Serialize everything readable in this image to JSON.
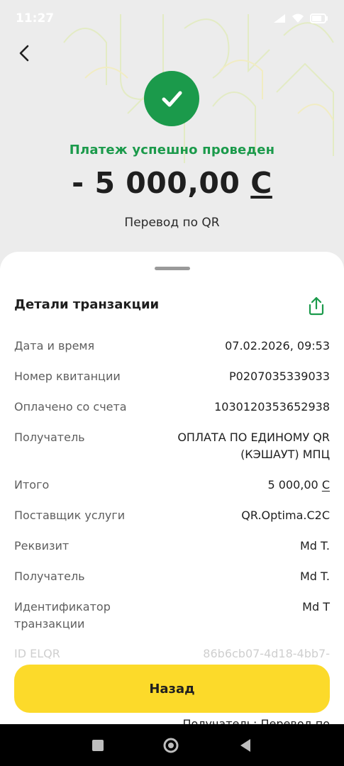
{
  "status_bar": {
    "time": "11:27"
  },
  "header": {
    "status_text": "Платеж успешно проведен",
    "amount_number": "- 5 000,00",
    "currency_symbol": "С",
    "subtitle": "Перевод по QR"
  },
  "details": {
    "title": "Детали транзакции",
    "rows": [
      {
        "label": "Дата и время",
        "value": "07.02.2026, 09:53"
      },
      {
        "label": "Номер квитанции",
        "value": "P0207035339033"
      },
      {
        "label": "Оплачено со счета",
        "value": "1030120353652938"
      },
      {
        "label": "Получатель",
        "value": "ОПЛАТА ПО ЕДИНОМУ QR (КЭШАУТ) МПЦ"
      },
      {
        "label": "Итого",
        "value": "5 000,00",
        "currency": "С"
      },
      {
        "label": "Поставщик услуги",
        "value": "QR.Optima.C2C"
      },
      {
        "label": "Реквизит",
        "value": "Md T."
      },
      {
        "label": "Получатель",
        "value": "Md T."
      },
      {
        "label": "Идентификатор транзакции",
        "value": "Md T"
      },
      {
        "label": "ID ELQR",
        "value": "86b6cb07-4d18-4bb7-"
      }
    ],
    "footer_text": "Получатель: Перевод по"
  },
  "actions": {
    "back_label": "Назад"
  },
  "colors": {
    "accent_green": "#1b9a4b",
    "button_yellow": "#fcda2a"
  },
  "icons": [
    "back-arrow-icon",
    "check-icon",
    "share-icon",
    "square-icon",
    "circle-icon",
    "triangle-back-icon"
  ]
}
